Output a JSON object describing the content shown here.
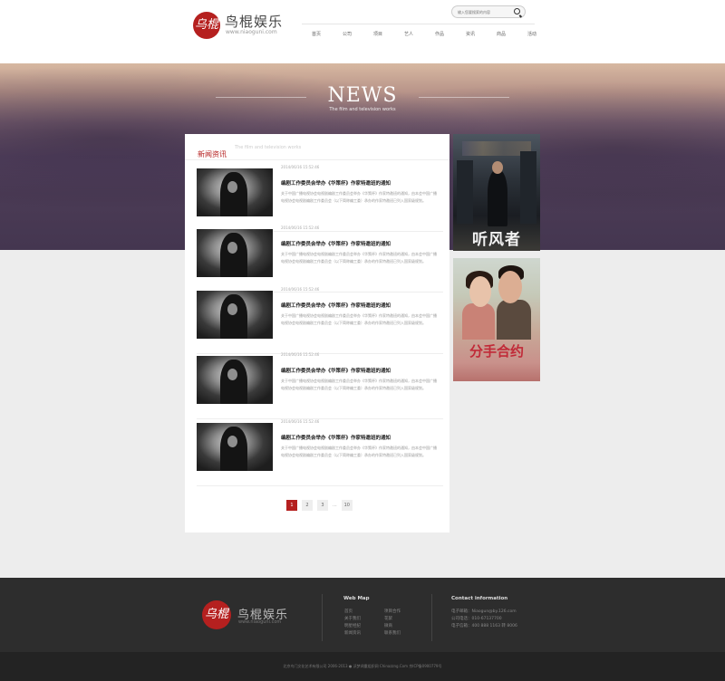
{
  "header": {
    "logo_mark": "乌棍",
    "logo_name": "鸟棍娱乐",
    "logo_url": "www.niaoguni.com",
    "search_placeholder": "输入您要搜索的内容",
    "nav": [
      {
        "label": "首页",
        "active": true
      },
      {
        "label": "公司",
        "active": false
      },
      {
        "label": "项目",
        "active": false
      },
      {
        "label": "艺人",
        "active": false
      },
      {
        "label": "作品",
        "active": false
      },
      {
        "label": "资讯",
        "active": false
      },
      {
        "label": "商品",
        "active": false
      },
      {
        "label": "活动",
        "active": false
      }
    ]
  },
  "banner": {
    "title": "NEWS",
    "subtitle": "The film and television works"
  },
  "panel": {
    "title": "新闻资讯",
    "subtitle": "The film and television works",
    "items": [
      {
        "date": "2014/06/16 15:52:46",
        "title": "编剧工作委员会举办《华策杯》作家特邀班的通知",
        "desc": "关于中国广播电视协会电视剧编剧工作委员会举办《华策杯》作家特邀班的通知，由本会中国广播电视协会电视剧编剧工作委员会（以下简称编工委）承办的作家特邀班已列入国家级规划。"
      },
      {
        "date": "2014/06/16 15:52:46",
        "title": "编剧工作委员会举办《华策杯》作家特邀班的通知",
        "desc": "关于中国广播电视协会电视剧编剧工作委员会举办《华策杯》作家特邀班的通知，由本会中国广播电视协会电视剧编剧工作委员会（以下简称编工委）承办的作家特邀班已列入国家级规划。"
      },
      {
        "date": "2014/06/16 15:52:46",
        "title": "编剧工作委员会举办《华策杯》作家特邀班的通知",
        "desc": "关于中国广播电视协会电视剧编剧工作委员会举办《华策杯》作家特邀班的通知，由本会中国广播电视协会电视剧编剧工作委员会（以下简称编工委）承办的作家特邀班已列入国家级规划。"
      },
      {
        "date": "2014/06/16 15:52:46",
        "title": "编剧工作委员会举办《华策杯》作家特邀班的通知",
        "desc": "关于中国广播电视协会电视剧编剧工作委员会举办《华策杯》作家特邀班的通知，由本会中国广播电视协会电视剧编剧工作委员会（以下简称编工委）承办的作家特邀班已列入国家级规划。"
      },
      {
        "date": "2014/06/16 15:52:46",
        "title": "编剧工作委员会举办《华策杯》作家特邀班的通知",
        "desc": "关于中国广播电视协会电视剧编剧工作委员会举办《华策杯》作家特邀班的通知，由本会中国广播电视协会电视剧编剧工作委员会（以下简称编工委）承办的作家特邀班已列入国家级规划。"
      }
    ],
    "pager": {
      "pages": [
        "1",
        "2",
        "3"
      ],
      "ellipsis": "...",
      "last": "10",
      "current": "1"
    }
  },
  "posters": [
    {
      "title": "听风者"
    },
    {
      "title": "分手合约"
    }
  ],
  "footer": {
    "logo_mark": "乌棍",
    "logo_name": "鸟棍娱乐",
    "logo_url": "www.niaoguni.com",
    "webmap_title": "Web Map",
    "webmap_col1": [
      "首页",
      "关于我们",
      "明星经纪",
      "新闻资讯"
    ],
    "webmap_col2": [
      "项目合作",
      "花絮",
      "微商",
      "联系我们"
    ],
    "contact_title": "Contact information",
    "contact_lines": [
      "电子邮箱：Niaogun@by.126.com",
      "公司电话：010-67137700",
      "电子信箱：400 888 1163 转 8006"
    ],
    "copyright": "北京鸟门文化艺术有限公司 2006-2013 ● 沃梦凋重组织网 Chinazzng.Com 京ICP备0900779号"
  }
}
